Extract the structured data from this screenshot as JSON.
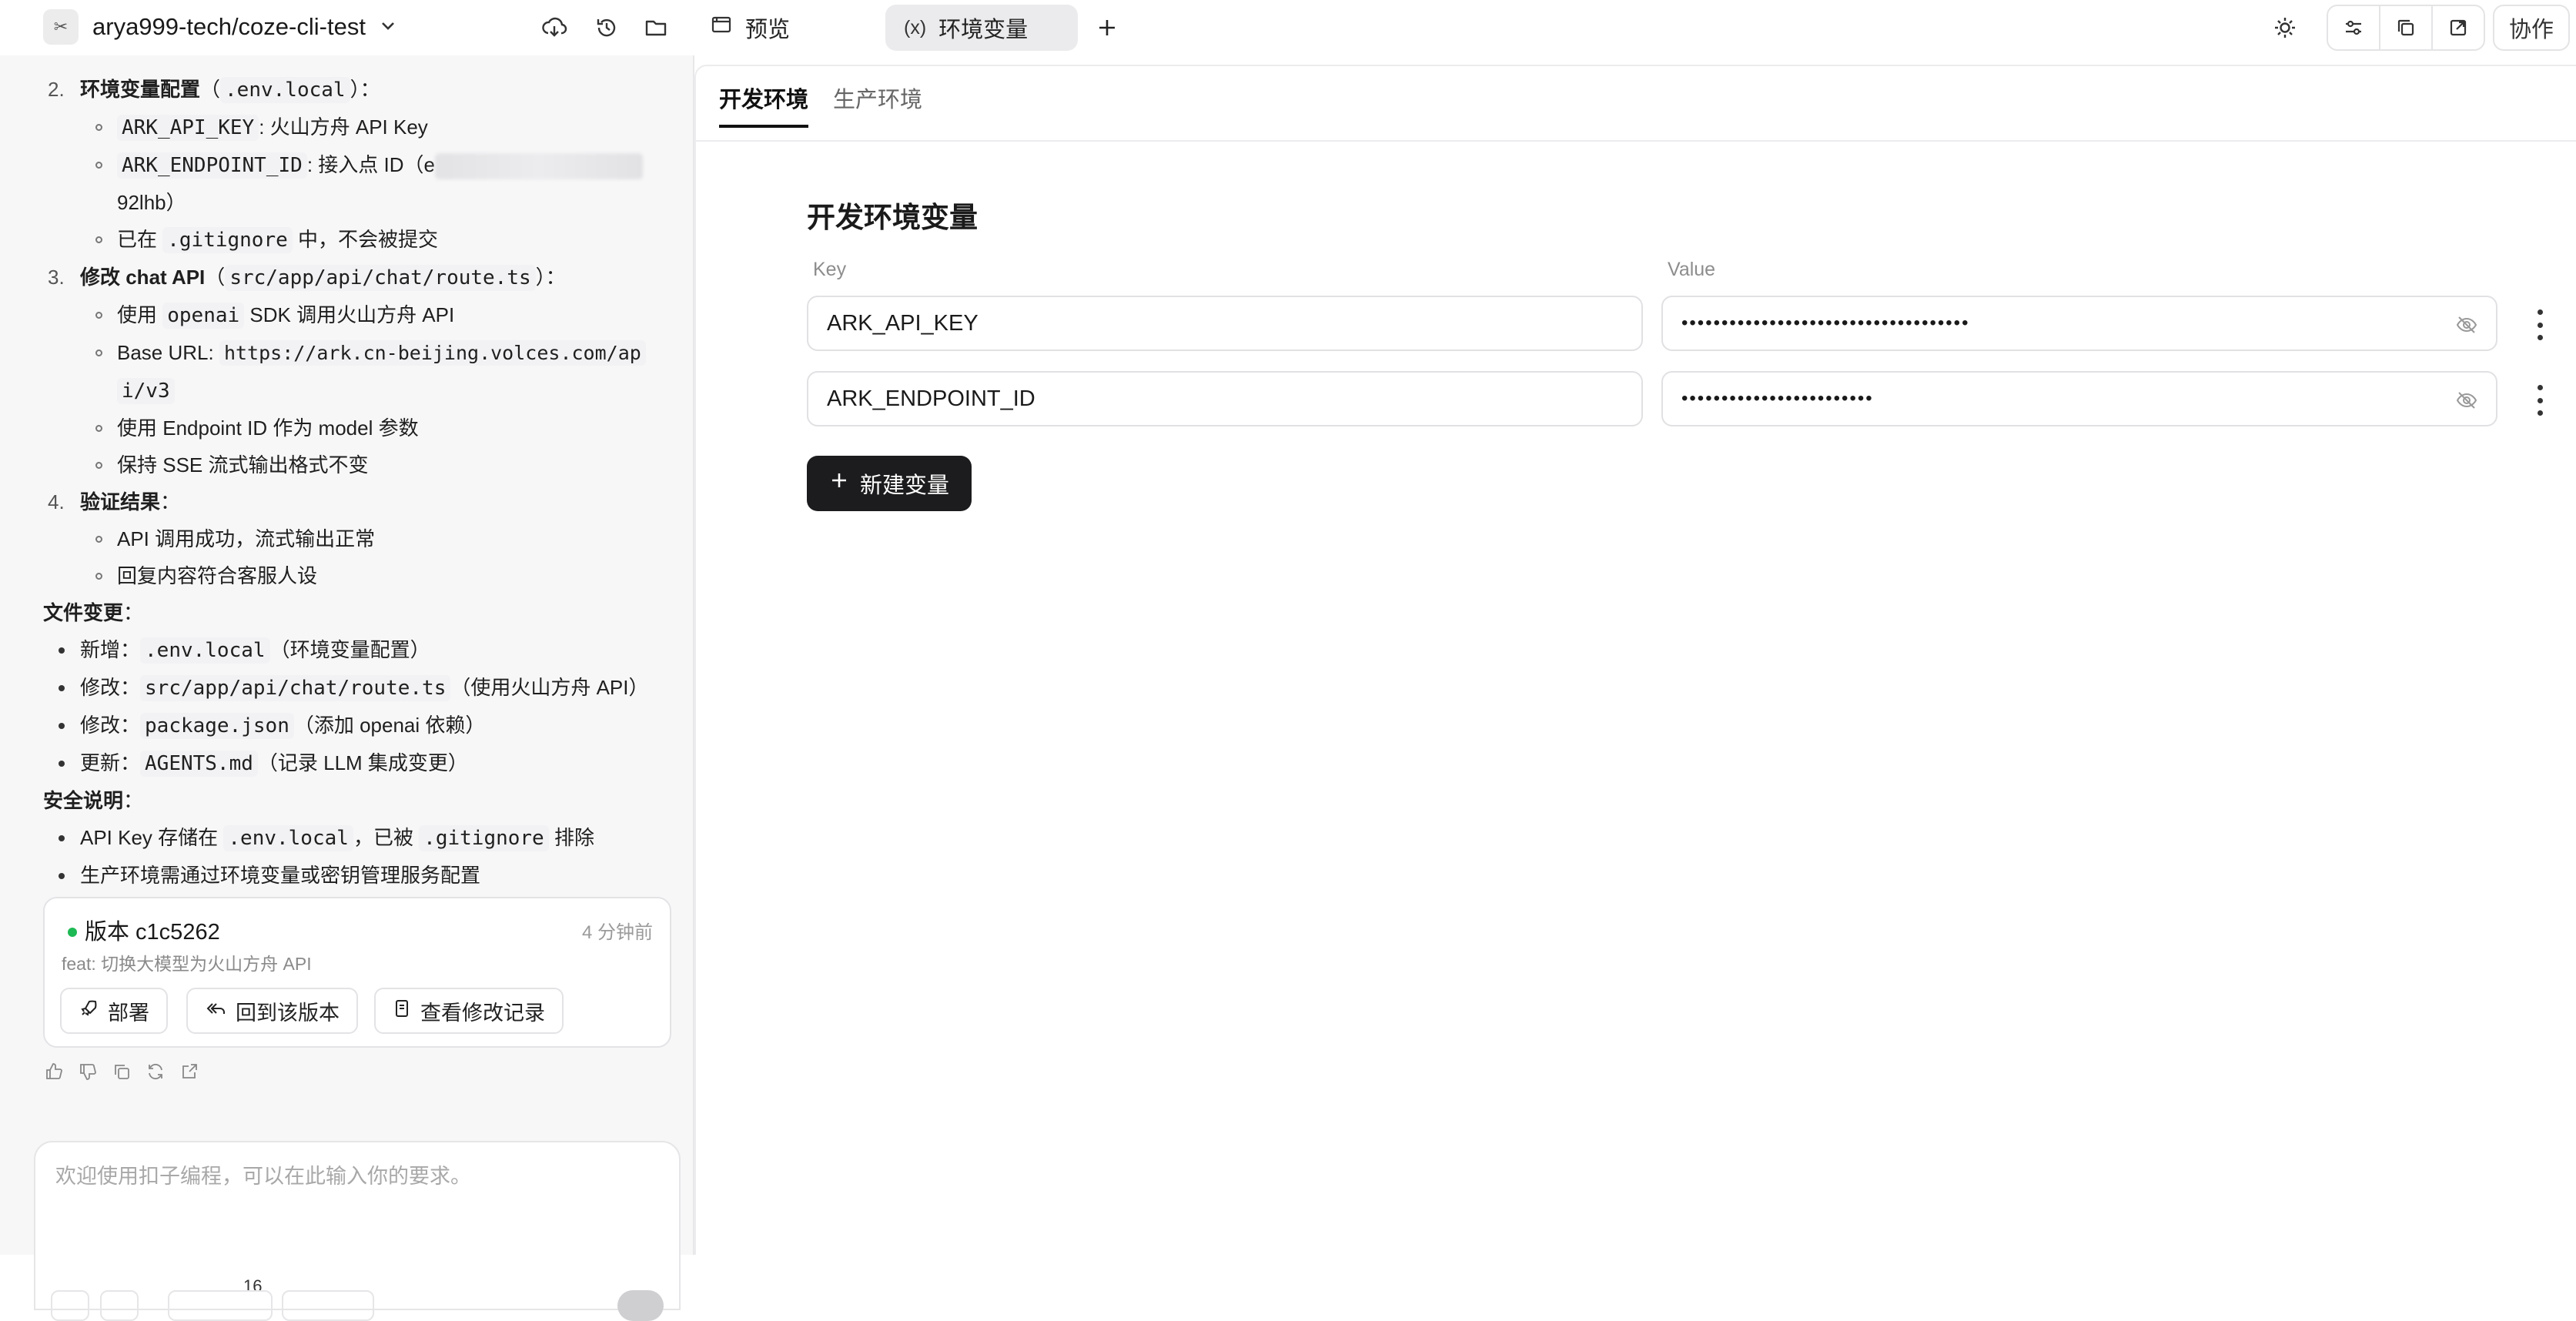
{
  "header": {
    "project_name": "arya999-tech/coze-cli-test",
    "tabs": [
      {
        "label": "预览"
      },
      {
        "label": "环境变量"
      }
    ],
    "collab_label": "协作"
  },
  "chat": {
    "steps": [
      {
        "num": "2.",
        "title": "环境变量配置",
        "title_code": ".env.local",
        "suffix": "：",
        "items": [
          {
            "parts": [
              {
                "code": "ARK_API_KEY"
              },
              {
                "text": ": 火山方舟 API Key"
              }
            ]
          },
          {
            "parts": [
              {
                "code": "ARK_ENDPOINT_ID"
              },
              {
                "text": ": 接入点 ID（e"
              }
            ],
            "cont": "92lhb）"
          },
          {
            "parts": [
              {
                "text": "已在 "
              },
              {
                "code": ".gitignore"
              },
              {
                "text": " 中，不会被提交"
              }
            ]
          }
        ]
      },
      {
        "num": "3.",
        "title": "修改 chat API",
        "title_code": "src/app/api/chat/route.ts",
        "suffix": "：",
        "items": [
          {
            "parts": [
              {
                "text": "使用 "
              },
              {
                "code": "openai"
              },
              {
                "text": " SDK 调用火山方舟 API"
              }
            ]
          },
          {
            "parts": [
              {
                "text": "Base URL: "
              },
              {
                "code": "https://ark.cn-beijing.volces.com/ap"
              }
            ],
            "cont_code": "i/v3"
          },
          {
            "parts": [
              {
                "text": "使用 Endpoint ID 作为 model 参数"
              }
            ]
          },
          {
            "parts": [
              {
                "text": "保持 SSE 流式输出格式不变"
              }
            ]
          }
        ]
      },
      {
        "num": "4.",
        "title": "验证结果",
        "suffix": "：",
        "items": [
          {
            "parts": [
              {
                "text": "API 调用成功，流式输出正常"
              }
            ]
          },
          {
            "parts": [
              {
                "text": "回复内容符合客服人设"
              }
            ]
          }
        ]
      }
    ],
    "file_changes_title": "文件变更",
    "file_changes": [
      {
        "label": "新增：",
        "code": ".env.local",
        "note": "（环境变量配置）"
      },
      {
        "label": "修改：",
        "code": "src/app/api/chat/route.ts",
        "note": "（使用火山方舟 API）"
      },
      {
        "label": "修改：",
        "code": "package.json",
        "note": "（添加 openai 依赖）"
      },
      {
        "label": "更新：",
        "code": "AGENTS.md",
        "note": "（记录 LLM 集成变更）"
      }
    ],
    "security_title": "安全说明",
    "security_items": [
      {
        "a": "API Key 存储在 ",
        "c1": ".env.local",
        "b": "，已被 ",
        "c2": ".gitignore",
        "d": " 排除"
      },
      {
        "a": "生产环境需通过环境变量或密钥管理服务配置"
      }
    ],
    "version_card": {
      "title": "版本 c1c5262",
      "time": "4 分钟前",
      "message": "feat: 切换大模型为火山方舟 API",
      "buttons": [
        "部署",
        "回到该版本",
        "查看修改记录"
      ]
    },
    "input": {
      "placeholder": "欢迎使用扣子编程，可以在此输入你的要求。",
      "count": "16"
    }
  },
  "env": {
    "tabs": [
      "开发环境",
      "生产环境"
    ],
    "section_title": "开发环境变量",
    "key_header": "Key",
    "value_header": "Value",
    "rows": [
      {
        "key": "ARK_API_KEY",
        "masked": "••••••••••••••••••••••••••••••••••••"
      },
      {
        "key": "ARK_ENDPOINT_ID",
        "masked": "••••••••••••••••••••••••"
      }
    ],
    "add_label": "新建变量"
  },
  "colors": {
    "accent": "#1c1c1e",
    "status_green": "#1db954"
  }
}
